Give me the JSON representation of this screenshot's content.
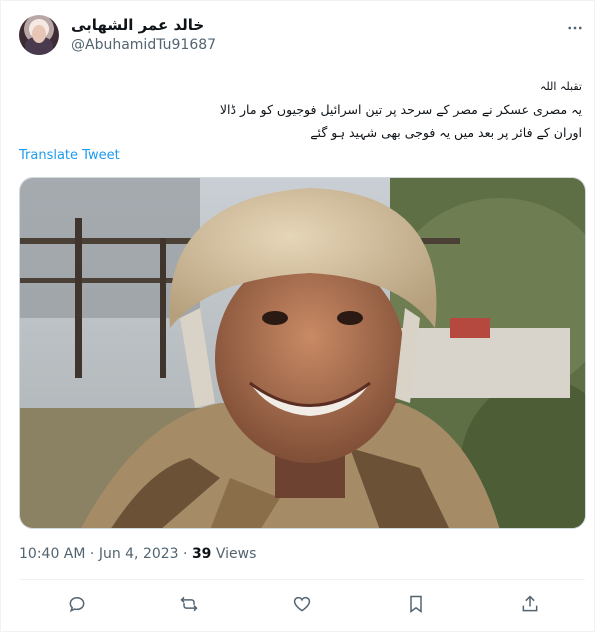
{
  "author": {
    "display_name": "خالد عمر الشهابی",
    "handle": "@AbuhamidTu91687"
  },
  "tweet": {
    "lines": [
      "تقبلہ اللہ",
      "یہ مصری عسکر نے مصر کے سرحد پر تین اسرائیل فوجیوں کو مار ڈالا",
      "اوران کے فائر پر بعد میں یہ فوجی بھی شہید ہو گئے"
    ],
    "translate_label": "Translate Tweet"
  },
  "meta": {
    "time": "10:40 AM",
    "separator1": " · ",
    "date": "Jun 4, 2023",
    "separator2": " · ",
    "views_count": "39",
    "views_label": " Views"
  },
  "icons": {
    "more": "more-dots-icon",
    "reply": "reply-icon",
    "retweet": "retweet-icon",
    "like": "heart-icon",
    "bookmark": "bookmark-icon",
    "share": "share-icon"
  },
  "colors": {
    "link": "#1d9bf0",
    "secondary_text": "#536471",
    "primary_text": "#0f1419"
  }
}
